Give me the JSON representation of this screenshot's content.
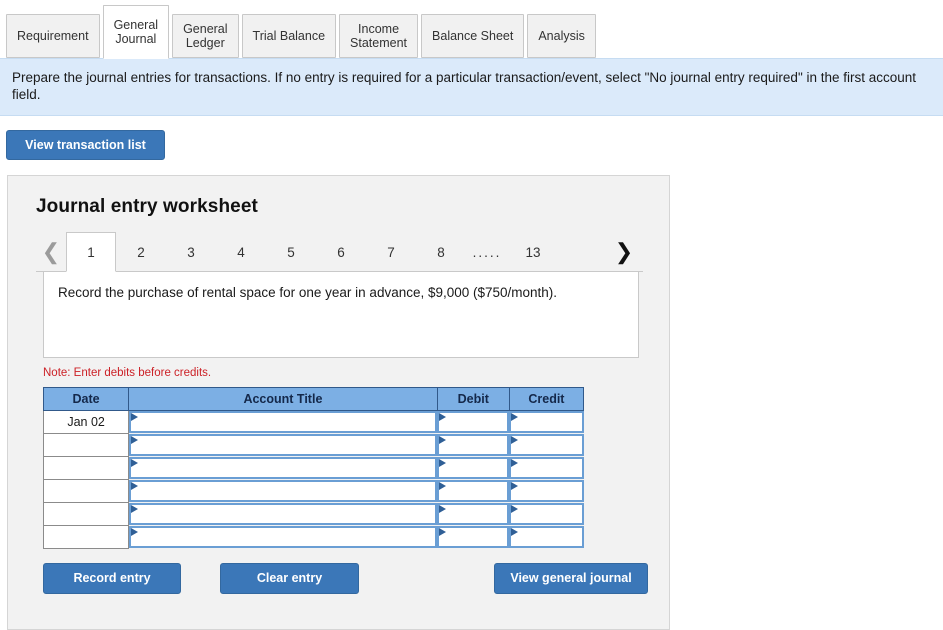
{
  "tabs": [
    {
      "label": "Requirement",
      "active": false
    },
    {
      "label": "General\nJournal",
      "active": true
    },
    {
      "label": "General\nLedger",
      "active": false
    },
    {
      "label": "Trial Balance",
      "active": false
    },
    {
      "label": "Income\nStatement",
      "active": false
    },
    {
      "label": "Balance Sheet",
      "active": false
    },
    {
      "label": "Analysis",
      "active": false
    }
  ],
  "banner": {
    "text": "Prepare the journal entries for transactions. If no entry is required for a particular transaction/event, select \"No journal entry required\" in the first account field."
  },
  "toolbar": {
    "view_transaction_list_label": "View transaction list"
  },
  "worksheet": {
    "title": "Journal entry worksheet",
    "pager": {
      "prev_icon": "chevron-left",
      "next_icon": "chevron-right",
      "pages": [
        "1",
        "2",
        "3",
        "4",
        "5",
        "6",
        "7",
        "8"
      ],
      "ellipsis": ".....",
      "last_page": "13",
      "active_page": "1"
    },
    "description": "Record the purchase of rental space for one year in advance, $9,000 ($750/month).",
    "note": "Note: Enter debits before credits.",
    "table": {
      "headers": [
        "Date",
        "Account Title",
        "Debit",
        "Credit"
      ],
      "rows": [
        {
          "date": "Jan 02",
          "account": "",
          "debit": "",
          "credit": ""
        },
        {
          "date": "",
          "account": "",
          "debit": "",
          "credit": ""
        },
        {
          "date": "",
          "account": "",
          "debit": "",
          "credit": ""
        },
        {
          "date": "",
          "account": "",
          "debit": "",
          "credit": ""
        },
        {
          "date": "",
          "account": "",
          "debit": "",
          "credit": ""
        },
        {
          "date": "",
          "account": "",
          "debit": "",
          "credit": ""
        }
      ]
    },
    "buttons": {
      "record_entry": "Record entry",
      "clear_entry": "Clear entry",
      "view_general_journal": "View general journal"
    }
  },
  "colors": {
    "accent_blue": "#3b77b8",
    "table_header_blue": "#7cafe4",
    "banner_blue": "#dbeafa",
    "note_red": "#cc2127",
    "panel_gray": "#f2f2f2"
  }
}
